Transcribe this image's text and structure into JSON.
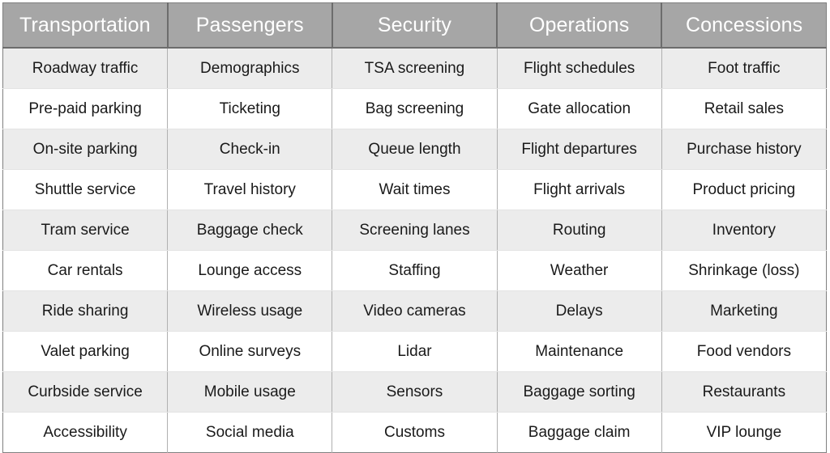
{
  "table": {
    "headers": [
      "Transportation",
      "Passengers",
      "Security",
      "Operations",
      "Concessions"
    ],
    "header_background": "#a6a6a6",
    "header_text_color": "#ffffff",
    "row_shaded_background": "#ececec",
    "row_plain_background": "#ffffff",
    "rows": [
      [
        "Roadway traffic",
        "Demographics",
        "TSA screening",
        "Flight schedules",
        "Foot traffic"
      ],
      [
        "Pre-paid parking",
        "Ticketing",
        "Bag screening",
        "Gate allocation",
        "Retail sales"
      ],
      [
        "On-site parking",
        "Check-in",
        "Queue length",
        "Flight departures",
        "Purchase history"
      ],
      [
        "Shuttle service",
        "Travel history",
        "Wait times",
        "Flight arrivals",
        "Product pricing"
      ],
      [
        "Tram service",
        "Baggage check",
        "Screening lanes",
        "Routing",
        "Inventory"
      ],
      [
        "Car rentals",
        "Lounge access",
        "Staffing",
        "Weather",
        "Shrinkage (loss)"
      ],
      [
        "Ride sharing",
        "Wireless usage",
        "Video cameras",
        "Delays",
        "Marketing"
      ],
      [
        "Valet parking",
        "Online surveys",
        "Lidar",
        "Maintenance",
        "Food vendors"
      ],
      [
        "Curbside service",
        "Mobile usage",
        "Sensors",
        "Baggage sorting",
        "Restaurants"
      ],
      [
        "Accessibility",
        "Social media",
        "Customs",
        "Baggage claim",
        "VIP lounge"
      ]
    ]
  }
}
